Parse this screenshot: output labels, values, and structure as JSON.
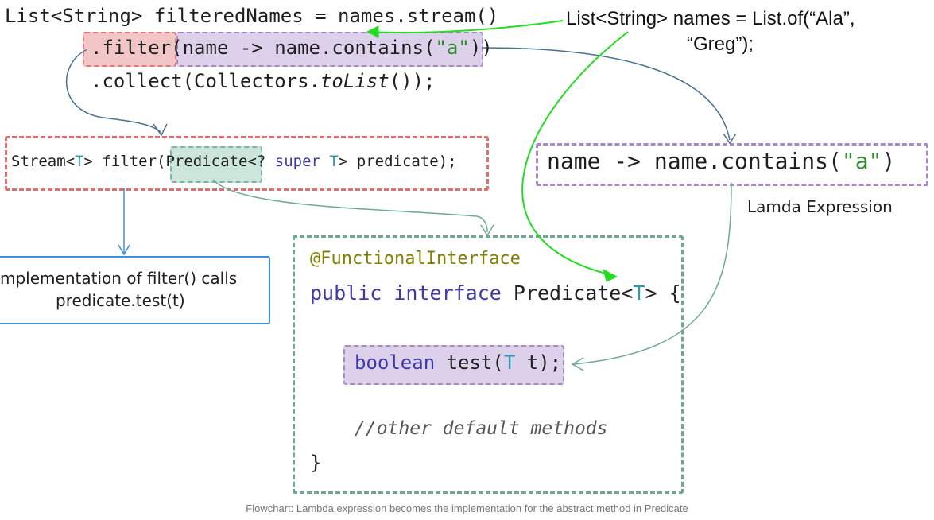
{
  "code": {
    "line1_decl": "List<String> filteredNames = ",
    "line1_names": "names",
    "line1_stream": ".stream()",
    "line2_filter": ".filter(",
    "line2_lambda_a": "name -> name.contains(",
    "line2_lambda_str": "\"a\"",
    "line2_close": "))",
    "line3_a": ".collect(Collectors.",
    "line3_tolist": "toList",
    "line3_b": "());"
  },
  "signature": {
    "a": "Stream<",
    "t1": "T",
    "b": "> filter(",
    "predicate": "Predicate",
    "c": "<? ",
    "super": "super",
    "d": " ",
    "t2": "T",
    "e": "> predicate);"
  },
  "lambda_box": {
    "a": "name -> name.contains(",
    "str": "\"a\"",
    "b": ")",
    "caption": "Lamda Expression"
  },
  "names_note": {
    "line1": "List<String> names = List.of(“Ala”,",
    "line2": "“Greg”);"
  },
  "impl_note": {
    "line1": "mplementation of filter() calls",
    "line2": "predicate.test(t)"
  },
  "interface_box": {
    "annotation": "@FunctionalInterface",
    "public": "public",
    "interface": "interface",
    "name": " Predicate<",
    "t": "T",
    "brace": "> {",
    "method_kw": "boolean",
    "method_a": " test(",
    "method_t": "T",
    "method_b": " t);",
    "comment": "//other default methods",
    "close": "}"
  },
  "caption": "Flowchart: Lambda expression becomes the implementation for the abstract method in Predicate",
  "colors": {
    "red": "#e07070",
    "purple": "#a889c4",
    "green_box": "#6fa797",
    "blue": "#3d8fe0",
    "bright_green_arrow": "#22dd22"
  }
}
